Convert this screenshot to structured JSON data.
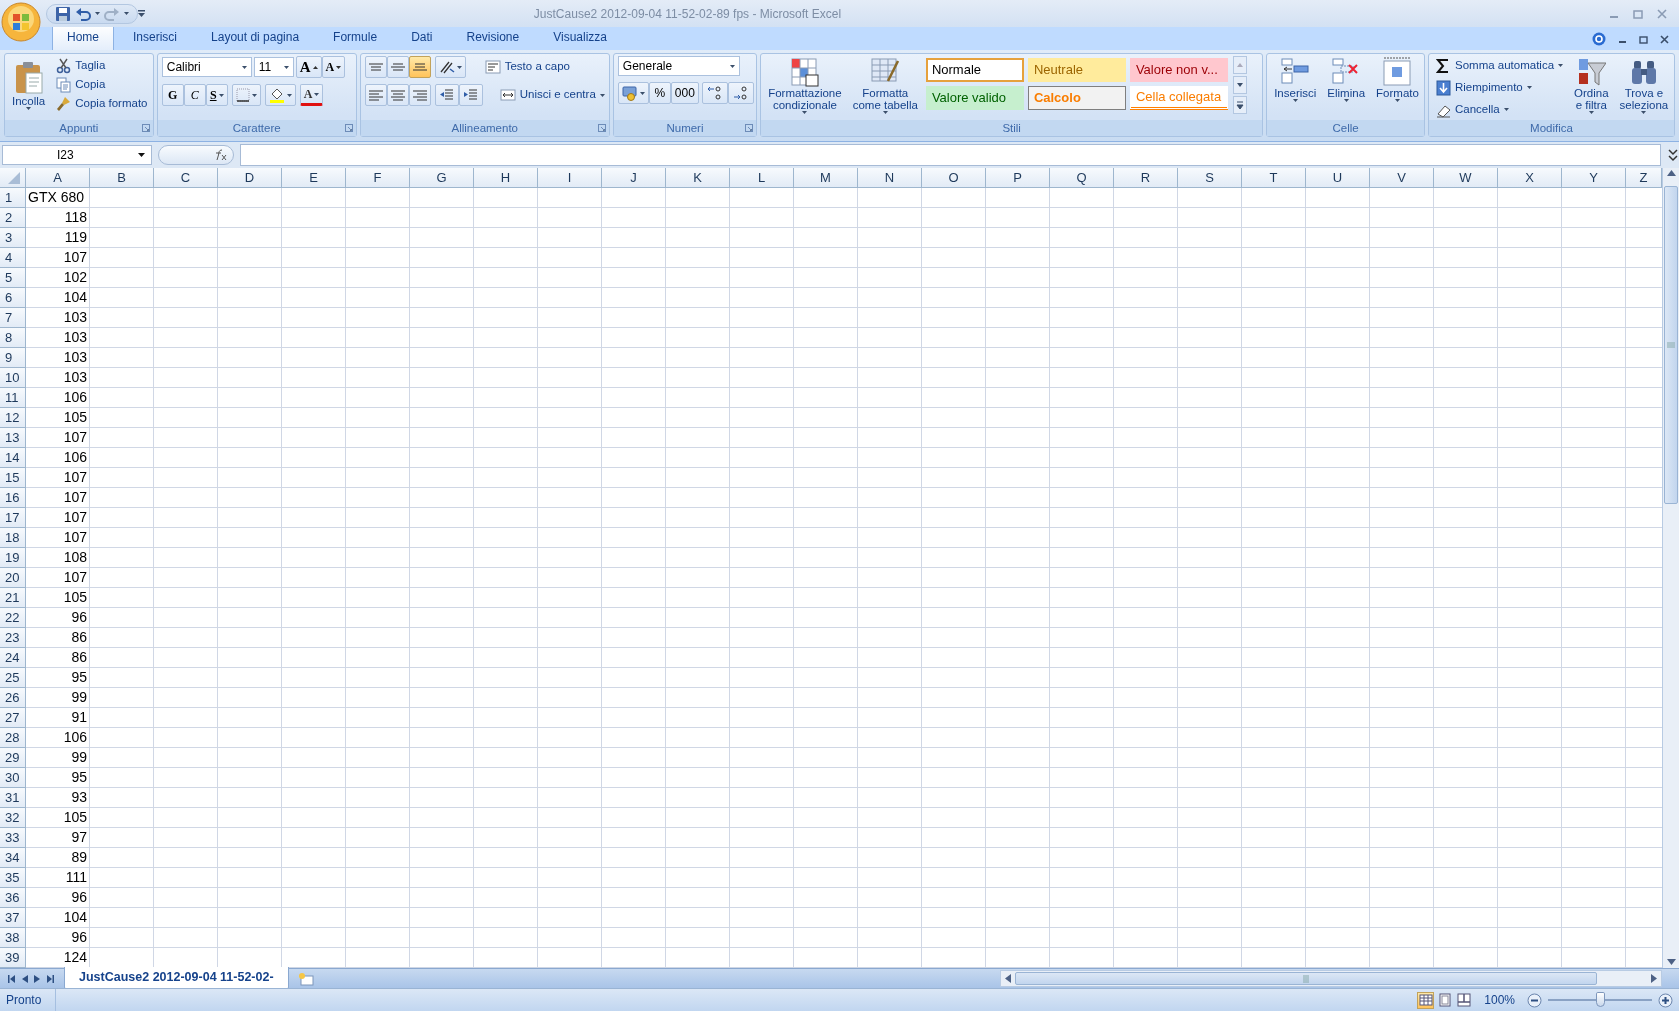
{
  "window": {
    "title": "JustCause2 2012-09-04 11-52-02-89 fps - Microsoft Excel"
  },
  "tabs": [
    {
      "label": "Home",
      "selected": true
    },
    {
      "label": "Inserisci",
      "selected": false
    },
    {
      "label": "Layout di pagina",
      "selected": false
    },
    {
      "label": "Formule",
      "selected": false
    },
    {
      "label": "Dati",
      "selected": false
    },
    {
      "label": "Revisione",
      "selected": false
    },
    {
      "label": "Visualizza",
      "selected": false
    }
  ],
  "ribbon": {
    "appunti": {
      "title": "Appunti",
      "paste": "Incolla",
      "items": [
        "Taglia",
        "Copia",
        "Copia formato"
      ]
    },
    "carattere": {
      "title": "Carattere",
      "font": "Calibri",
      "size": "11",
      "font_size_buttons": [
        {
          "kind": "grow",
          "label": "A"
        },
        {
          "kind": "shrink",
          "label": "A"
        }
      ],
      "styles": [
        {
          "kind": "bold",
          "label": "G"
        },
        {
          "kind": "italic",
          "label": "C"
        },
        {
          "kind": "underline",
          "label": "S"
        }
      ],
      "font_color": "A"
    },
    "allineamento": {
      "title": "Allineamento",
      "vertical": [
        {
          "kind": "top",
          "selected": false
        },
        {
          "kind": "middle",
          "selected": false
        },
        {
          "kind": "bottom",
          "selected": true
        }
      ],
      "wrap": "Testo a capo",
      "merge": "Unisci e centra"
    },
    "numeri": {
      "title": "Numeri",
      "format": "Generale",
      "percent": "%",
      "thousands": "000"
    },
    "stili": {
      "title": "Stili",
      "buttons": [
        "Formattazione\ncondizionale",
        "Formatta\ncome tabella"
      ],
      "styles": [
        {
          "label": "Normale",
          "kind": "normal",
          "selected": true
        },
        {
          "label": "Neutrale",
          "kind": "neutral",
          "selected": false
        },
        {
          "label": "Valore non v...",
          "kind": "bad",
          "selected": false
        },
        {
          "label": "Valore valido",
          "kind": "good",
          "selected": false
        },
        {
          "label": "Calcolo",
          "kind": "calc",
          "selected": false
        },
        {
          "label": "Cella collegata",
          "kind": "linked",
          "selected": false
        }
      ]
    },
    "celle": {
      "title": "Celle",
      "buttons": [
        "Inserisci",
        "Elimina",
        "Formato"
      ]
    },
    "modifica": {
      "title": "Modifica",
      "items": [
        "Somma automatica",
        "Riempimento",
        "Cancella"
      ],
      "buttons": [
        "Ordina\ne filtra",
        "Trova e\nseleziona"
      ]
    }
  },
  "name_box": "I23",
  "sheet": {
    "columns": [
      "A",
      "B",
      "C",
      "D",
      "E",
      "F",
      "G",
      "H",
      "I",
      "J",
      "K",
      "L",
      "M",
      "N",
      "O",
      "P",
      "Q",
      "R",
      "S",
      "T",
      "U",
      "V",
      "W",
      "X",
      "Y",
      "Z"
    ],
    "rows": [
      {
        "header": "1",
        "kind": "text",
        "a": "GTX 680"
      },
      {
        "header": "2",
        "kind": "number",
        "a": "118"
      },
      {
        "header": "3",
        "kind": "number",
        "a": "119"
      },
      {
        "header": "4",
        "kind": "number",
        "a": "107"
      },
      {
        "header": "5",
        "kind": "number",
        "a": "102"
      },
      {
        "header": "6",
        "kind": "number",
        "a": "104"
      },
      {
        "header": "7",
        "kind": "number",
        "a": "103"
      },
      {
        "header": "8",
        "kind": "number",
        "a": "103"
      },
      {
        "header": "9",
        "kind": "number",
        "a": "103"
      },
      {
        "header": "10",
        "kind": "number",
        "a": "103"
      },
      {
        "header": "11",
        "kind": "number",
        "a": "106"
      },
      {
        "header": "12",
        "kind": "number",
        "a": "105"
      },
      {
        "header": "13",
        "kind": "number",
        "a": "107"
      },
      {
        "header": "14",
        "kind": "number",
        "a": "106"
      },
      {
        "header": "15",
        "kind": "number",
        "a": "107"
      },
      {
        "header": "16",
        "kind": "number",
        "a": "107"
      },
      {
        "header": "17",
        "kind": "number",
        "a": "107"
      },
      {
        "header": "18",
        "kind": "number",
        "a": "107"
      },
      {
        "header": "19",
        "kind": "number",
        "a": "108"
      },
      {
        "header": "20",
        "kind": "number",
        "a": "107"
      },
      {
        "header": "21",
        "kind": "number",
        "a": "105"
      },
      {
        "header": "22",
        "kind": "number",
        "a": "96"
      },
      {
        "header": "23",
        "kind": "number",
        "a": "86"
      },
      {
        "header": "24",
        "kind": "number",
        "a": "86"
      },
      {
        "header": "25",
        "kind": "number",
        "a": "95"
      },
      {
        "header": "26",
        "kind": "number",
        "a": "99"
      },
      {
        "header": "27",
        "kind": "number",
        "a": "91"
      },
      {
        "header": "28",
        "kind": "number",
        "a": "106"
      },
      {
        "header": "29",
        "kind": "number",
        "a": "99"
      },
      {
        "header": "30",
        "kind": "number",
        "a": "95"
      },
      {
        "header": "31",
        "kind": "number",
        "a": "93"
      },
      {
        "header": "32",
        "kind": "number",
        "a": "105"
      },
      {
        "header": "33",
        "kind": "number",
        "a": "97"
      },
      {
        "header": "34",
        "kind": "number",
        "a": "89"
      },
      {
        "header": "35",
        "kind": "number",
        "a": "111"
      },
      {
        "header": "36",
        "kind": "number",
        "a": "96"
      },
      {
        "header": "37",
        "kind": "number",
        "a": "104"
      },
      {
        "header": "38",
        "kind": "number",
        "a": "96"
      },
      {
        "header": "39",
        "kind": "number",
        "a": "124"
      }
    ]
  },
  "sheet_tabs": [
    {
      "label": "JustCause2 2012-09-04 11-52-02-",
      "selected": true
    }
  ],
  "status_bar": {
    "text": "Pronto",
    "views": [
      {
        "kind": "normal",
        "selected": true
      },
      {
        "kind": "layout",
        "selected": false
      },
      {
        "kind": "pagebreak",
        "selected": false
      }
    ],
    "zoom": "100%",
    "zoom_slider": {
      "level": 0.5
    }
  }
}
